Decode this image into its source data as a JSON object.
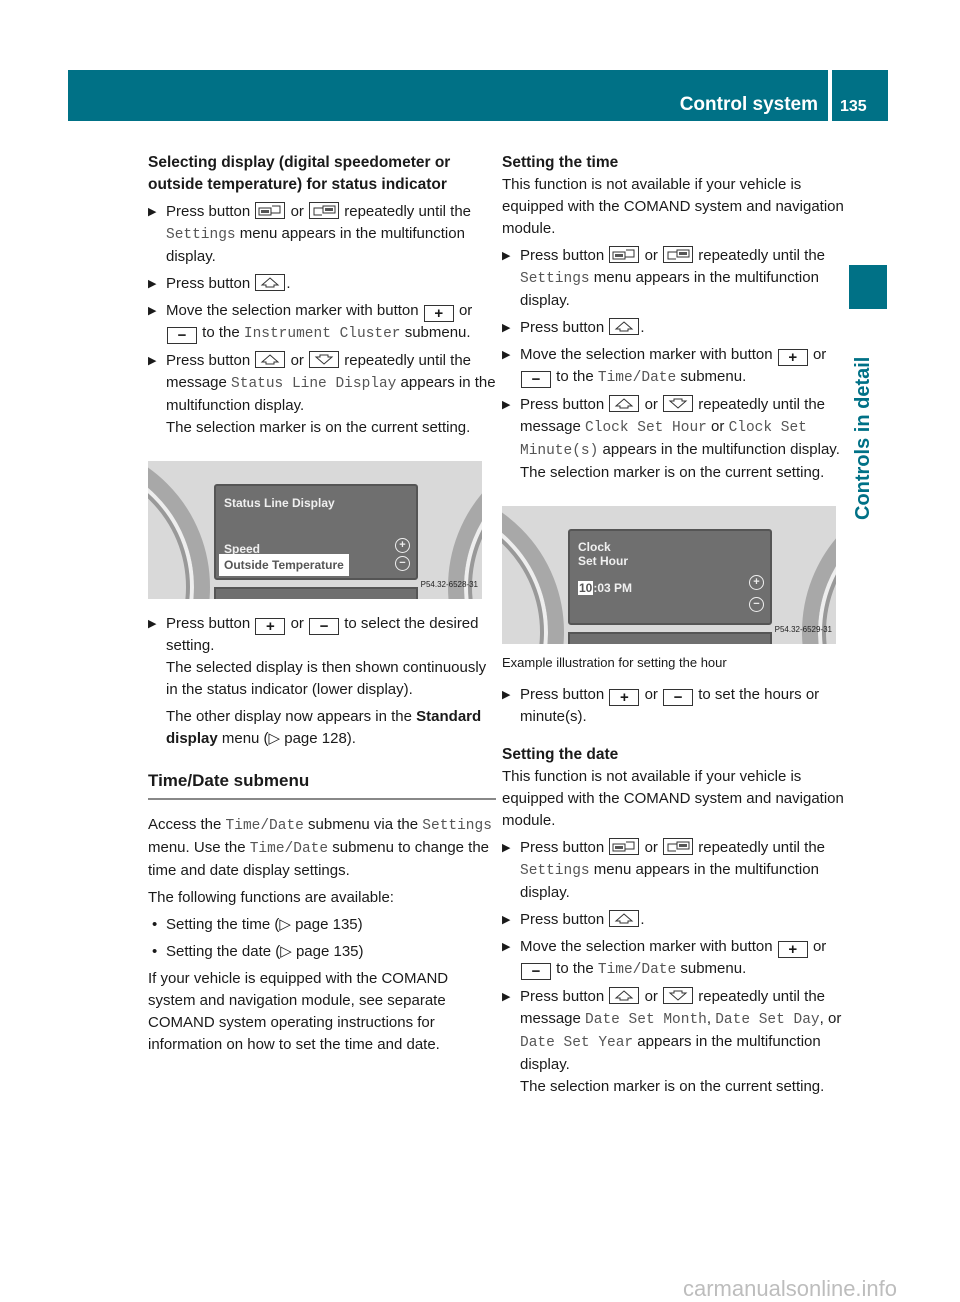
{
  "header": {
    "title": "Control system",
    "page_number": "135"
  },
  "side_tab": {
    "label": "Controls in detail"
  },
  "left": {
    "heading": "Selecting display (digital speedometer or outside temperature) for status indicator",
    "step1": {
      "a": "Press button",
      "b": "or",
      "c": "repeatedly until the",
      "mono": "Settings",
      "d": "menu appears in the multifunction display."
    },
    "step2": {
      "a": "Press button",
      "b": "."
    },
    "step3": {
      "a": "Move the selection marker with button",
      "b": "or",
      "c": "to the",
      "mono": "Instrument Cluster",
      "d": "submenu."
    },
    "step4": {
      "a": "Press button",
      "b": "or",
      "c": "repeatedly until the message",
      "mono": "Status Line Display",
      "d": "appears in the multifunction display.",
      "e": "The selection marker is on the current setting."
    },
    "illustration": {
      "title": "Status Line Display",
      "option1": "Speed",
      "option2": "Outside Temperature",
      "ref": "P54.32-6528-31"
    },
    "step5": {
      "a": "Press button",
      "b": "or",
      "c": "to select the desired setting.",
      "d": "The selected display is then shown continuously in the status indicator (lower display).",
      "e1": "The other display now appears in the",
      "e2": "Standard display",
      "e3": "menu (▷ page 128)."
    },
    "section": "Time/Date submenu",
    "intro": {
      "a": "Access the",
      "m1": "Time/Date",
      "b": "submenu via the",
      "m2": "Settings",
      "c": "menu. Use the",
      "m3": "Time/Date",
      "d": "submenu to change the time and date display settings."
    },
    "available": "The following functions are available:",
    "bullets": [
      "Setting the time (▷ page 135)",
      "Setting the date (▷ page 135)"
    ],
    "comand_note": "If your vehicle is equipped with the COMAND system and navigation module, see separate COMAND system operating instructions for information on how to set the time and date."
  },
  "right": {
    "time_heading": "Setting the time",
    "time_note": "This function is not available if your vehicle is equipped with the COMAND system and navigation module.",
    "t1": {
      "a": "Press button",
      "b": "or",
      "c": "repeatedly until the",
      "mono": "Settings",
      "d": "menu appears in the multifunction display."
    },
    "t2": {
      "a": "Press button",
      "b": "."
    },
    "t3": {
      "a": "Move the selection marker with button",
      "b": "or",
      "c": "to the",
      "mono": "Time/Date",
      "d": "submenu."
    },
    "t4": {
      "a": "Press button",
      "b": "or",
      "c": "repeatedly until the message",
      "m1": "Clock Set Hour",
      "or": "or",
      "m2": "Clock Set Minute(s)",
      "d": "appears in the multifunction display.",
      "e": "The selection marker is on the current setting."
    },
    "illustration": {
      "line1": "Clock",
      "line2": "Set Hour",
      "hour": "10",
      "rest": ":03 PM",
      "ref": "P54.32-6529-31"
    },
    "caption": "Example illustration for setting the hour",
    "t5": {
      "a": "Press button",
      "b": "or",
      "c": "to set the hours or minute(s)."
    },
    "date_heading": "Setting the date",
    "date_note": "This function is not available if your vehicle is equipped with the COMAND system and navigation module.",
    "d1": {
      "a": "Press button",
      "b": "or",
      "c": "repeatedly until the",
      "mono": "Settings",
      "d": "menu appears in the multifunction display."
    },
    "d2": {
      "a": "Press button",
      "b": "."
    },
    "d3": {
      "a": "Move the selection marker with button",
      "b": "or",
      "c": "to the",
      "mono": "Time/Date",
      "d": "submenu."
    },
    "d4": {
      "a": "Press button",
      "b": "or",
      "c": "repeatedly until the message",
      "m1": "Date Set Month",
      "s1": ",",
      "m2": "Date Set Day",
      "s2": ", or",
      "m3": "Date Set Year",
      "d": "appears in the multifunction display.",
      "e": "The selection marker is on the current setting."
    }
  },
  "watermark": "carmanualsonline.info",
  "colors": {
    "brand": "#007186"
  }
}
